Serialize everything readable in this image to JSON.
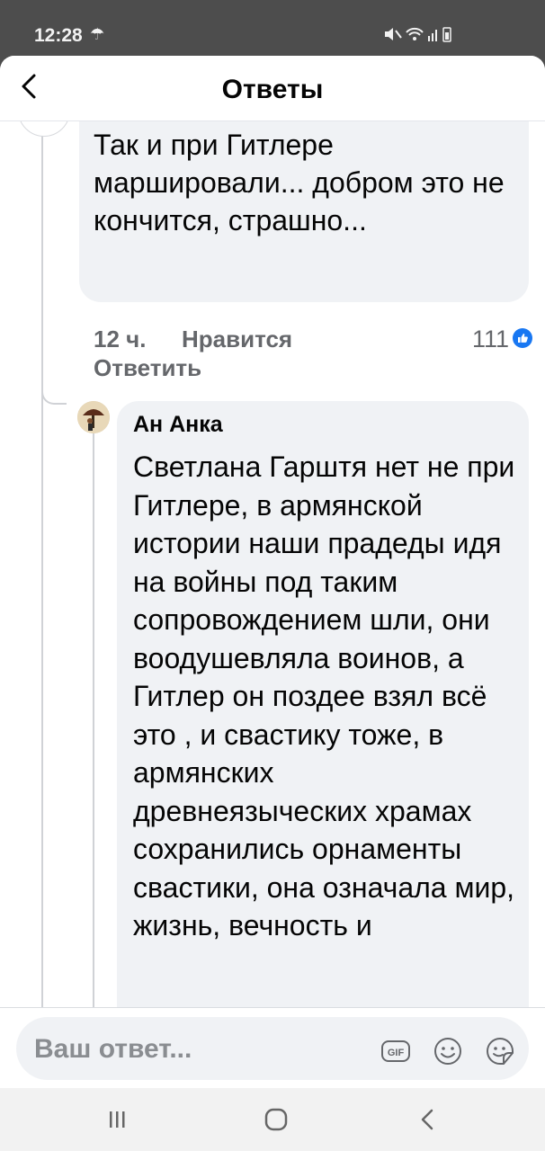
{
  "status_bar": {
    "time": "12:28",
    "weather_glyph": "☂",
    "icons_text": "🔇 ≋ .ıl ▯"
  },
  "header": {
    "title": "Ответы"
  },
  "comment": {
    "text": "Так и при Гитлере маршировали... добром это не кончится, страшно...",
    "time": "12 ч.",
    "like_label": "Нравится",
    "reactions_count": "111",
    "reply_label": "Ответить"
  },
  "reply": {
    "author": "Ан Анка",
    "text": "Светлана Гарштя нет не при Гитлере, в армянской истории наши прадеды идя на войны под таким сопровождением шли, они воодушевляла воинов, а Гитлер он поздее взял всё это , и свастику тоже, в армянских древнеязыческих храмах сохранились орнаменты свастики, она означала мир, жизнь, вечность и"
  },
  "compose": {
    "placeholder": "Ваш ответ..."
  },
  "colors": {
    "accent": "#1877f2",
    "bubble": "#f0f2f5",
    "secondary_text": "#65676b"
  }
}
